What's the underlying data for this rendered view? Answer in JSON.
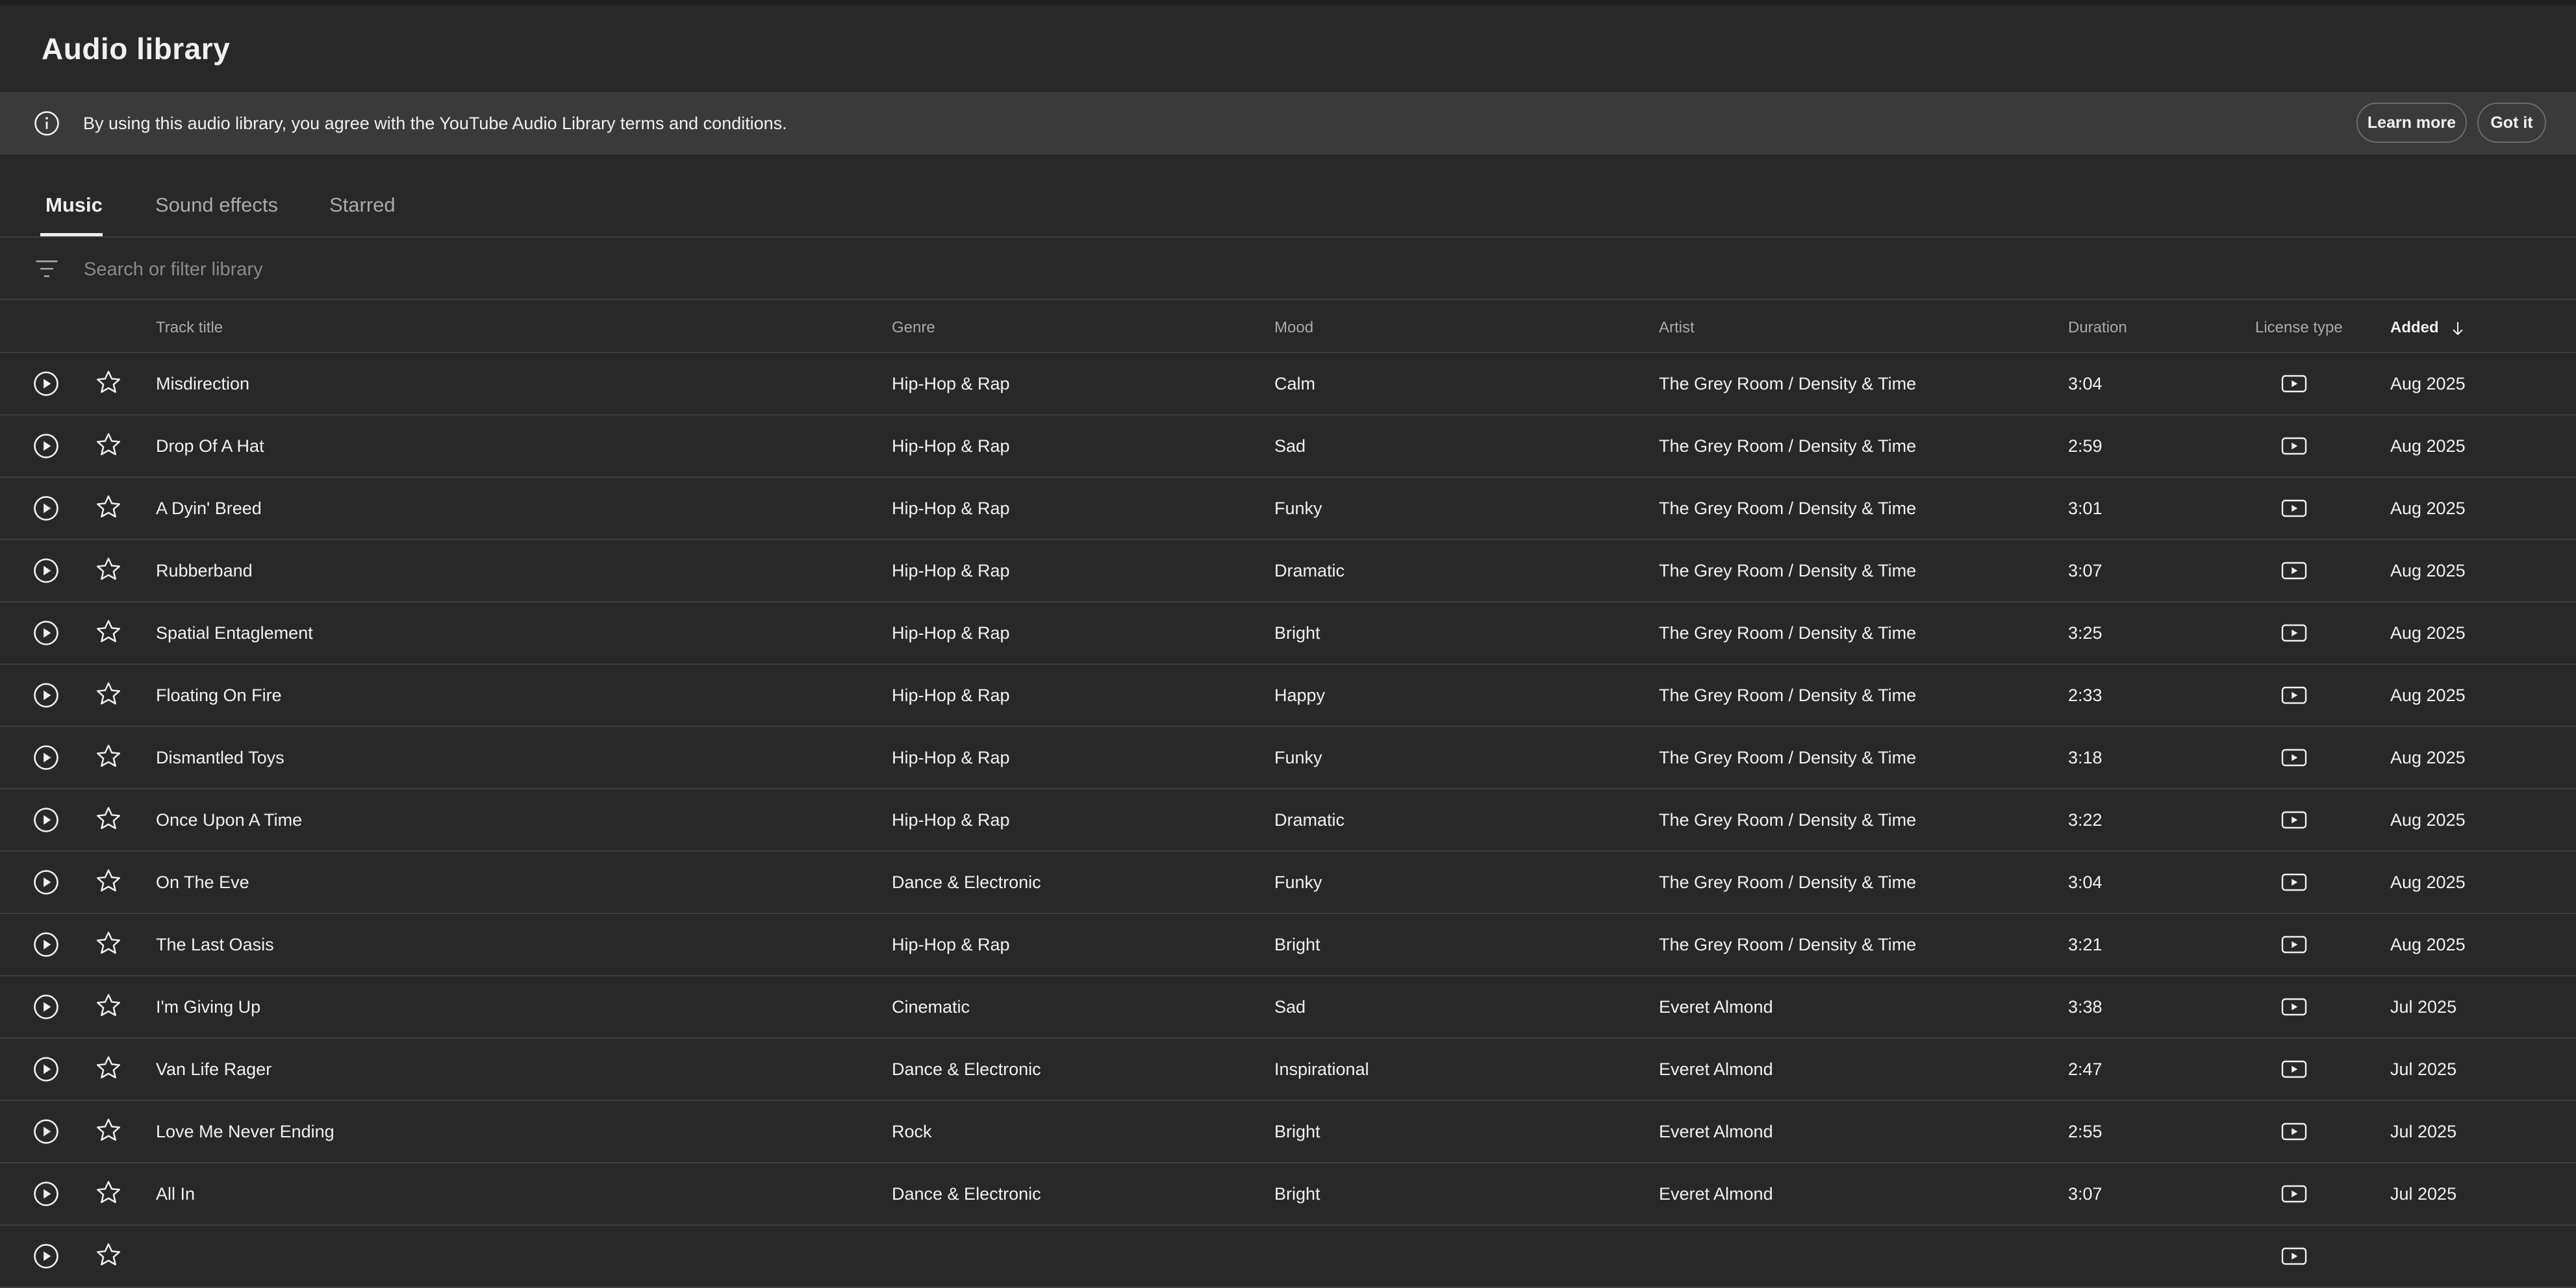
{
  "page": {
    "title": "Audio library"
  },
  "banner": {
    "text": "By using this audio library, you agree with the YouTube Audio Library terms and conditions.",
    "learn_more": "Learn more",
    "got_it": "Got it",
    "icon": "info-icon"
  },
  "tabs": [
    {
      "label": "Music",
      "active": true
    },
    {
      "label": "Sound effects",
      "active": false
    },
    {
      "label": "Starred",
      "active": false
    }
  ],
  "search": {
    "placeholder": "Search or filter library",
    "value": ""
  },
  "columns": {
    "title": "Track title",
    "genre": "Genre",
    "mood": "Mood",
    "artist": "Artist",
    "duration": "Duration",
    "license": "License type",
    "added": "Added",
    "sort": "descending"
  },
  "rows": [
    {
      "title": "Misdirection",
      "genre": "Hip-Hop & Rap",
      "mood": "Calm",
      "artist": "The Grey Room / Density & Time",
      "duration": "3:04",
      "added": "Aug 2025"
    },
    {
      "title": "Drop Of A Hat",
      "genre": "Hip-Hop & Rap",
      "mood": "Sad",
      "artist": "The Grey Room / Density & Time",
      "duration": "2:59",
      "added": "Aug 2025"
    },
    {
      "title": "A Dyin' Breed",
      "genre": "Hip-Hop & Rap",
      "mood": "Funky",
      "artist": "The Grey Room / Density & Time",
      "duration": "3:01",
      "added": "Aug 2025"
    },
    {
      "title": "Rubberband",
      "genre": "Hip-Hop & Rap",
      "mood": "Dramatic",
      "artist": "The Grey Room / Density & Time",
      "duration": "3:07",
      "added": "Aug 2025"
    },
    {
      "title": "Spatial Entaglement",
      "genre": "Hip-Hop & Rap",
      "mood": "Bright",
      "artist": "The Grey Room / Density & Time",
      "duration": "3:25",
      "added": "Aug 2025"
    },
    {
      "title": "Floating On Fire",
      "genre": "Hip-Hop & Rap",
      "mood": "Happy",
      "artist": "The Grey Room / Density & Time",
      "duration": "2:33",
      "added": "Aug 2025"
    },
    {
      "title": "Dismantled Toys",
      "genre": "Hip-Hop & Rap",
      "mood": "Funky",
      "artist": "The Grey Room / Density & Time",
      "duration": "3:18",
      "added": "Aug 2025"
    },
    {
      "title": "Once Upon A Time",
      "genre": "Hip-Hop & Rap",
      "mood": "Dramatic",
      "artist": "The Grey Room / Density & Time",
      "duration": "3:22",
      "added": "Aug 2025"
    },
    {
      "title": "On The Eve",
      "genre": "Dance & Electronic",
      "mood": "Funky",
      "artist": "The Grey Room / Density & Time",
      "duration": "3:04",
      "added": "Aug 2025"
    },
    {
      "title": "The Last Oasis",
      "genre": "Hip-Hop & Rap",
      "mood": "Bright",
      "artist": "The Grey Room / Density & Time",
      "duration": "3:21",
      "added": "Aug 2025"
    },
    {
      "title": "I'm Giving Up",
      "genre": "Cinematic",
      "mood": "Sad",
      "artist": "Everet Almond",
      "duration": "3:38",
      "added": "Jul 2025"
    },
    {
      "title": "Van Life Rager",
      "genre": "Dance & Electronic",
      "mood": "Inspirational",
      "artist": "Everet Almond",
      "duration": "2:47",
      "added": "Jul 2025"
    },
    {
      "title": "Love Me Never Ending",
      "genre": "Rock",
      "mood": "Bright",
      "artist": "Everet Almond",
      "duration": "2:55",
      "added": "Jul 2025"
    },
    {
      "title": "All In",
      "genre": "Dance & Electronic",
      "mood": "Bright",
      "artist": "Everet Almond",
      "duration": "3:07",
      "added": "Jul 2025"
    },
    {
      "title": "",
      "genre": "",
      "mood": "",
      "artist": "",
      "duration": "",
      "added": ""
    }
  ],
  "icons": {
    "play": "play-circle-icon",
    "star": "star-outline-icon",
    "license": "youtube-license-icon",
    "filter": "filter-icon",
    "sort": "arrow-down-icon"
  },
  "colors": {
    "background": "#282828",
    "banner": "#3a3a3a",
    "text": "#f1f1f1",
    "muted": "#aaaaaa",
    "divider": "#3e3e3e"
  }
}
